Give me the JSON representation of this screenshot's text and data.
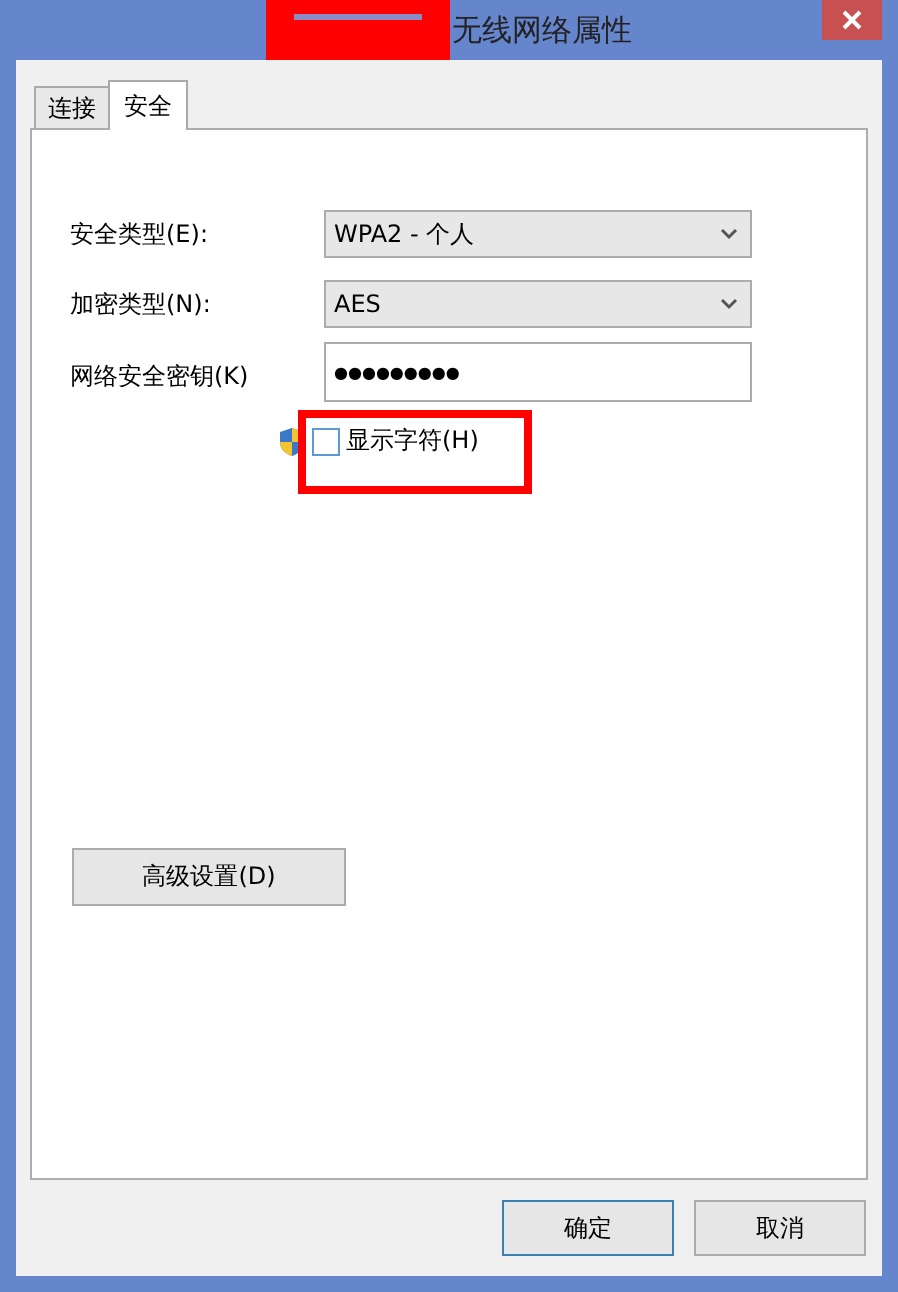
{
  "window": {
    "title": "无线网络属性",
    "title_redacted": true
  },
  "tabs": [
    {
      "label": "连接",
      "selected": false
    },
    {
      "label": "安全",
      "selected": true
    }
  ],
  "fields": [
    {
      "kind": "dropdown",
      "label": "安全类型(E):",
      "value": "WPA2 - 个人"
    },
    {
      "kind": "dropdown",
      "label": "加密类型(N):",
      "value": "AES"
    },
    {
      "kind": "text",
      "label": "网络安全密钥(K)",
      "value": "●●●●●●●●●"
    }
  ],
  "show_characters": {
    "label": "显示字符(H)",
    "checked": false,
    "highlighted": true
  },
  "advanced_button": "高级设置(D)",
  "buttons": [
    {
      "label": "确定",
      "default": true
    },
    {
      "label": "取消",
      "default": false
    }
  ]
}
